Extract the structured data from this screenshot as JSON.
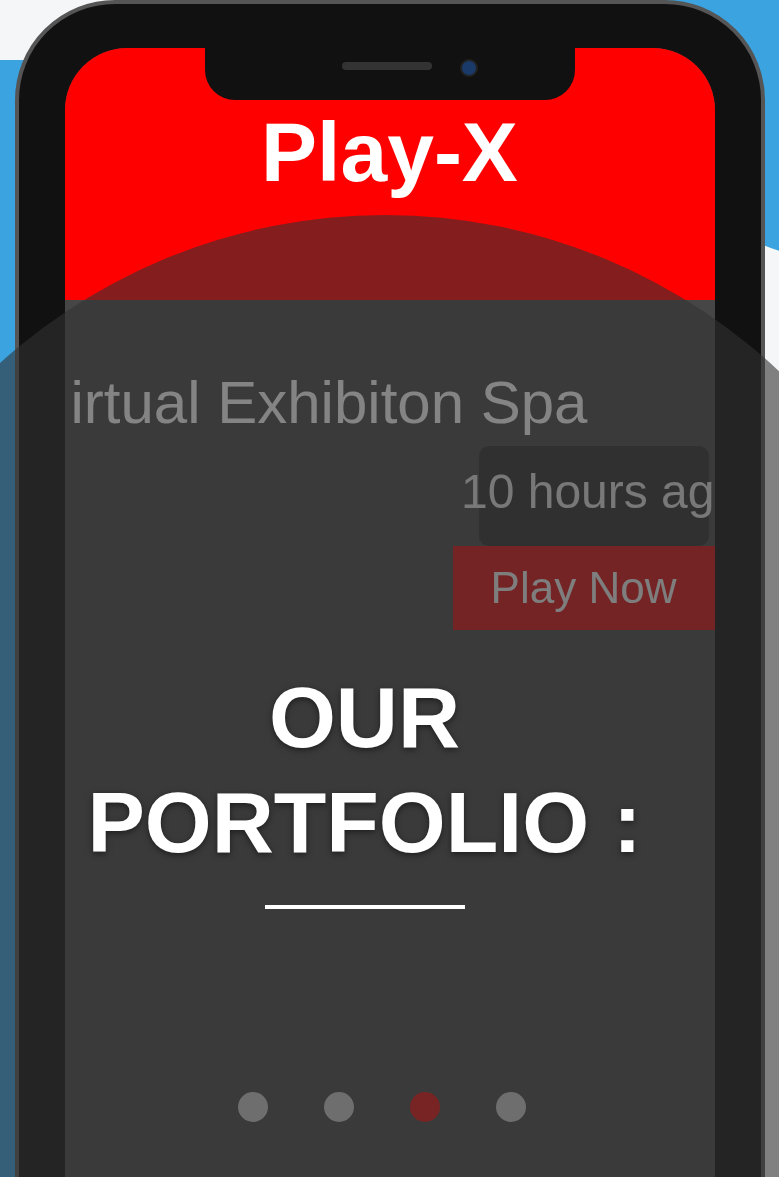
{
  "app": {
    "title": "Play-X",
    "card": {
      "title": "irtual Exhibiton Spa",
      "time": "10 hours ag",
      "button": "Play Now"
    },
    "dots": [
      {
        "selected": false
      },
      {
        "selected": false
      },
      {
        "selected": true
      },
      {
        "selected": false
      }
    ]
  },
  "overlay": {
    "heading": "OUR PORTFOLIO :"
  }
}
